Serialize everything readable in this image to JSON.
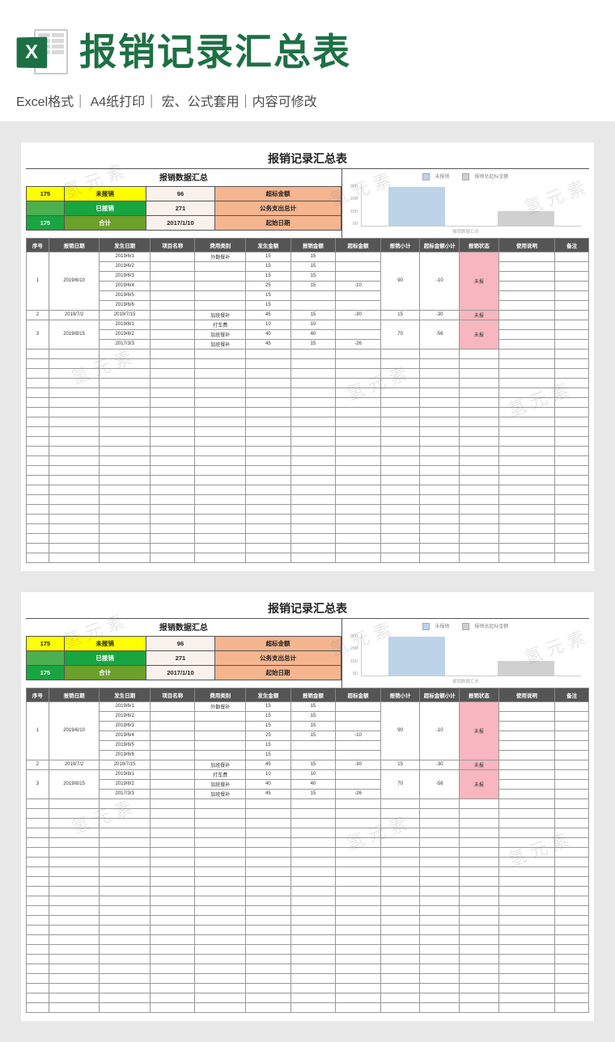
{
  "banner": {
    "logo_letter": "X",
    "title": "报销记录汇总表",
    "subtitle": "Excel格式｜ A4纸打印｜ 宏、公式套用｜内容可修改"
  },
  "watermark": "氢元素",
  "sheet": {
    "title": "报销记录汇总表",
    "summary_title": "报销数据汇总",
    "summary_rows": [
      {
        "a": "175",
        "b": "未报销",
        "c": "96",
        "d": "超标金额",
        "a_cls": "yellow",
        "b_cls": "yellow",
        "c_cls": "pale",
        "d_cls": "peach"
      },
      {
        "a": "",
        "b": "已报销",
        "c": "271",
        "d": "公务支出总计",
        "a_cls": "lime",
        "b_cls": "green",
        "c_cls": "pale",
        "d_cls": "peach"
      },
      {
        "a": "175",
        "b": "合计",
        "c": "2017/1/10",
        "d": "起始日期",
        "a_cls": "green",
        "b_cls": "olive",
        "c_cls": "pale",
        "d_cls": "peach"
      }
    ],
    "chart_legend": {
      "a": "未报销",
      "b": "报销总起标金额"
    },
    "chart_caption": "报销数据汇总",
    "headers": [
      "序号",
      "报销日期",
      "发生日期",
      "项目名称",
      "费用类别",
      "发生金额",
      "报销金额",
      "超标金额",
      "报销小计",
      "超标金额小计",
      "报销状态",
      "使用说明",
      "备注"
    ],
    "rows": [
      {
        "c": [
          "1",
          "2019/6/10",
          "2019/6/1",
          "",
          "外勤餐补",
          "15",
          "15",
          "",
          "90",
          "-10",
          "未报",
          "",
          ""
        ],
        "merge": 6,
        "pink": 10
      },
      {
        "c": [
          "",
          "",
          "2019/6/2",
          "",
          "",
          "15",
          "15",
          "",
          "",
          "",
          "",
          "",
          ""
        ]
      },
      {
        "c": [
          "",
          "",
          "2019/6/3",
          "",
          "",
          "15",
          "15",
          "",
          "",
          "",
          "",
          "",
          ""
        ]
      },
      {
        "c": [
          "",
          "",
          "2019/6/4",
          "",
          "",
          "25",
          "15",
          "-10",
          "",
          "",
          "",
          "",
          ""
        ]
      },
      {
        "c": [
          "",
          "",
          "2019/6/5",
          "",
          "",
          "15",
          "",
          "",
          "",
          "",
          "",
          "",
          ""
        ]
      },
      {
        "c": [
          "",
          "",
          "2019/6/6",
          "",
          "",
          "15",
          "",
          "",
          "",
          "",
          "",
          "",
          ""
        ]
      },
      {
        "c": [
          "2",
          "2019/7/2",
          "2019/7/15",
          "",
          "加班餐补",
          "45",
          "15",
          "-30",
          "15",
          "-30",
          "未报",
          "",
          ""
        ],
        "pink": 10
      },
      {
        "c": [
          "3",
          "2019/8/15",
          "2019/8/1",
          "",
          "打车费",
          "10",
          "10",
          "",
          "70",
          "-56",
          "未报",
          "",
          ""
        ],
        "merge": 3,
        "pink": 10
      },
      {
        "c": [
          "",
          "",
          "2019/8/2",
          "",
          "加班餐补",
          "40",
          "40",
          "",
          "",
          "",
          "",
          "",
          ""
        ]
      },
      {
        "c": [
          "",
          "",
          "2017/3/3",
          "",
          "加班餐补",
          "45",
          "15",
          "-26",
          "",
          "",
          "",
          "",
          ""
        ]
      }
    ],
    "blank_rows": 22
  },
  "chart_data": {
    "type": "bar",
    "categories": [
      "未报销",
      "报销总起标金额"
    ],
    "values": [
      271,
      96
    ],
    "title": "报销数据汇总",
    "xlabel": "",
    "ylabel": "",
    "ylim": [
      0,
      300
    ],
    "y_ticks": [
      300,
      200,
      150,
      50
    ]
  }
}
